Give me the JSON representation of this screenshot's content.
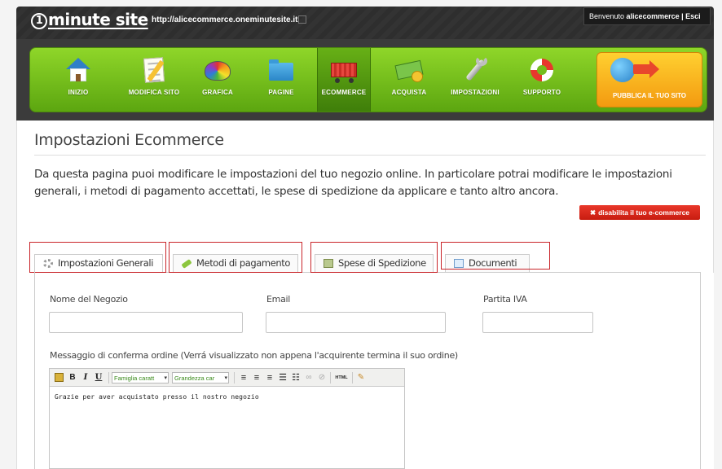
{
  "header": {
    "logo_digit": "1",
    "logo_rest": "minute site",
    "site_url": "http://alicecommerce.oneminutesite.it",
    "welcome_prefix": "Benvenuto ",
    "welcome_user": "alicecommerce",
    "welcome_sep": " | ",
    "logout_label": "Esci"
  },
  "nav": {
    "items": [
      {
        "label": "INIZIO",
        "icon": "home-icon"
      },
      {
        "label": "MODIFICA SITO",
        "icon": "edit-page-icon"
      },
      {
        "label": "GRAFICA",
        "icon": "palette-icon"
      },
      {
        "label": "PAGINE",
        "icon": "folder-icon"
      },
      {
        "label": "ECOMMERCE",
        "icon": "cart-icon",
        "active": true
      },
      {
        "label": "ACQUISTA",
        "icon": "money-icon"
      },
      {
        "label": "IMPOSTAZIONI",
        "icon": "wrench-icon"
      },
      {
        "label": "SUPPORTO",
        "icon": "lifebuoy-icon"
      }
    ],
    "publish_label": "PUBBLICA IL TUO SITO"
  },
  "page": {
    "title": "Impostazioni Ecommerce",
    "intro": "Da questa pagina puoi modificare le impostazioni del tuo negozio online. In particolare potrai modificare le impostazioni generali, i metodi di pagamento accettati, le spese di spedizione da applicare e tanto altro ancora.",
    "disable_button": "disabilita il tuo e-commerce"
  },
  "tabs": [
    {
      "label": "Impostazioni Generali",
      "icon": "gear-icon",
      "active": true
    },
    {
      "label": "Metodi di pagamento",
      "icon": "pencil-icon"
    },
    {
      "label": "Spese di Spedizione",
      "icon": "shipping-icon"
    },
    {
      "label": "Documenti",
      "icon": "document-icon"
    }
  ],
  "form": {
    "shop_name_label": "Nome del Negozio",
    "shop_name_value": "",
    "email_label": "Email",
    "email_value": "",
    "vat_label": "Partita IVA",
    "vat_value": "",
    "confirm_message_label": "Messaggio di conferma ordine (Verrá visualizzato non appena l'acquirente termina il suo ordine)",
    "editor": {
      "font_family_select": "Famiglia caratt",
      "font_size_select": "Grandezza car",
      "bold": "B",
      "italic": "I",
      "underline": "U",
      "html": "HTML",
      "content": "Grazie per aver acquistato presso il nostro negozio"
    }
  },
  "colors": {
    "nav_green": "#74bd1c",
    "publish_orange": "#f6b020",
    "disable_red": "#d8271b",
    "highlight_red": "#c9252a"
  }
}
